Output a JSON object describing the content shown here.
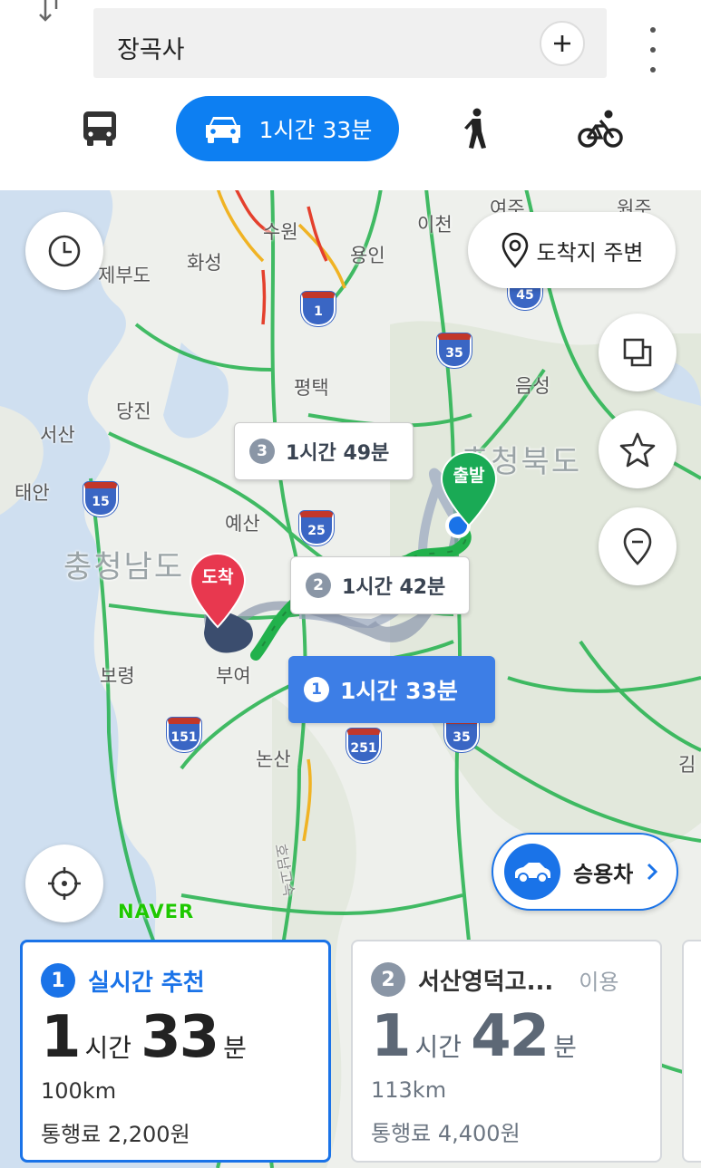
{
  "search": {
    "destination": "장곡사"
  },
  "modes": [
    {
      "name": "bus",
      "icon": "bus-icon"
    },
    {
      "name": "car",
      "icon": "car-icon",
      "label": "1시간 33분",
      "selected": true
    },
    {
      "name": "walk",
      "icon": "walk-icon"
    },
    {
      "name": "bike",
      "icon": "bike-icon"
    }
  ],
  "colors": {
    "accent": "#0d7ff2",
    "route_active": "#3d7ee6",
    "traffic_smooth": "#22b14c",
    "start_pin": "#1aaa55",
    "end_pin": "#e8384f"
  },
  "map": {
    "destination_nearby": "도착지 주변",
    "labels": {
      "suwon": "수원",
      "icheon": "이천",
      "hwaseong": "화성",
      "yongin": "용인",
      "jebudo": "제부도",
      "pyeongtaek": "평택",
      "eumseong": "음성",
      "dangjin": "당진",
      "seosan": "서산",
      "taean": "태안",
      "yesan": "예산",
      "boryeong": "보령",
      "buyeo": "부여",
      "nonsan": "논산",
      "chungbuk": "충청북도",
      "chungnam": "충청남도",
      "yeoju": "여주",
      "wonju": "원주",
      "gim": "김",
      "hwy_label": "호남고속"
    },
    "shields": [
      "1",
      "35",
      "15",
      "25",
      "151",
      "251",
      "35",
      "45"
    ],
    "pins": {
      "start": "출발",
      "end": "도착"
    },
    "callouts": [
      {
        "num": "3",
        "time": "1시간 49분"
      },
      {
        "num": "2",
        "time": "1시간 42분"
      },
      {
        "num": "1",
        "time": "1시간 33분"
      }
    ],
    "logo": "NAVER",
    "vehicle": "승용차"
  },
  "routes": [
    {
      "num": "1",
      "title": "실시간 추천",
      "hours": "1",
      "hours_unit": "시간",
      "minutes": "33",
      "minutes_unit": "분",
      "distance": "100km",
      "toll": "통행료 2,200원"
    },
    {
      "num": "2",
      "title": "서산영덕고...",
      "extra": "이용",
      "hours": "1",
      "hours_unit": "시간",
      "minutes": "42",
      "minutes_unit": "분",
      "distance": "113km",
      "toll": "통행료 4,400원"
    }
  ]
}
